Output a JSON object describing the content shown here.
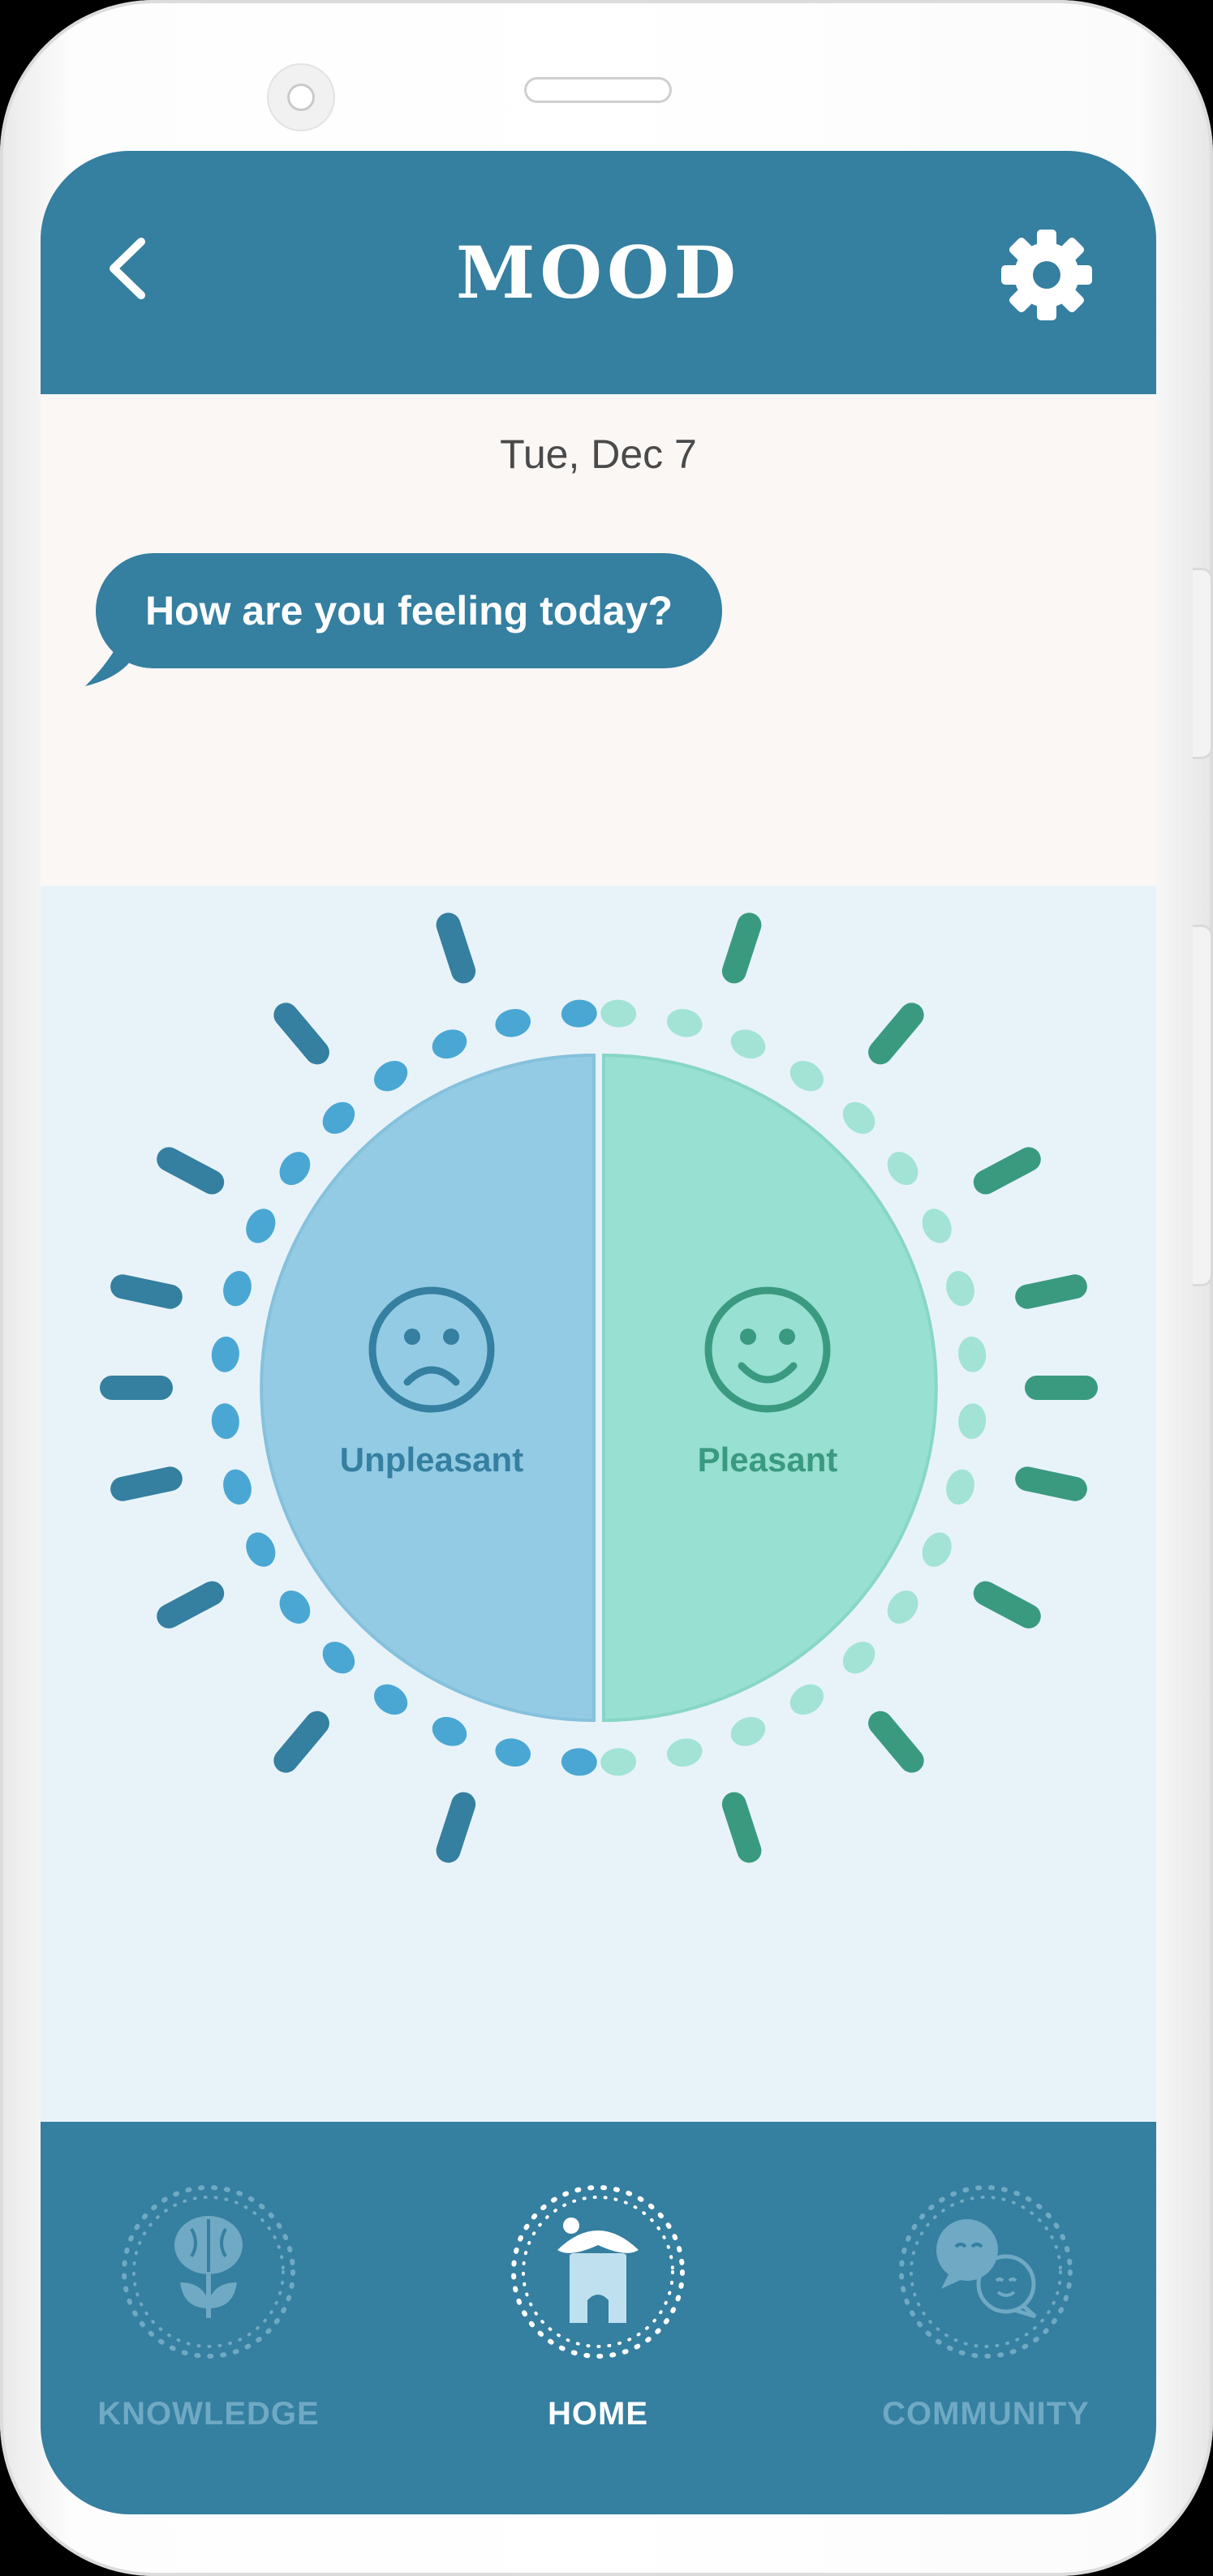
{
  "header": {
    "title": "MOOD",
    "back_icon": "chevron-left-icon",
    "settings_icon": "gear-icon"
  },
  "date_label": "Tue, Dec 7",
  "prompt": "How are you feeling today?",
  "mood_options": [
    {
      "label": "Unpleasant",
      "icon": "sad-face-icon"
    },
    {
      "label": "Pleasant",
      "icon": "happy-face-icon"
    }
  ],
  "nav": {
    "items": [
      {
        "label": "KNOWLEDGE",
        "icon": "brain-flower-icon",
        "active": false
      },
      {
        "label": "HOME",
        "icon": "home-icon",
        "active": true
      },
      {
        "label": "COMMUNITY",
        "icon": "chat-bubbles-icon",
        "active": false
      }
    ]
  },
  "colors": {
    "brand_blue": "#357fa0",
    "unpleasant_fill": "#93cbe4",
    "unpleasant_dark": "#357fa0",
    "unpleasant_dots": "#4aa7d3",
    "pleasant_fill": "#98e0d2",
    "pleasant_dark": "#3a9a80",
    "pleasant_dots": "#a2e3d5",
    "background": "#e8f3f9",
    "date_panel": "#faf7f5",
    "nav_inactive": "#8cbfd6",
    "nav_active": "#ffffff"
  }
}
